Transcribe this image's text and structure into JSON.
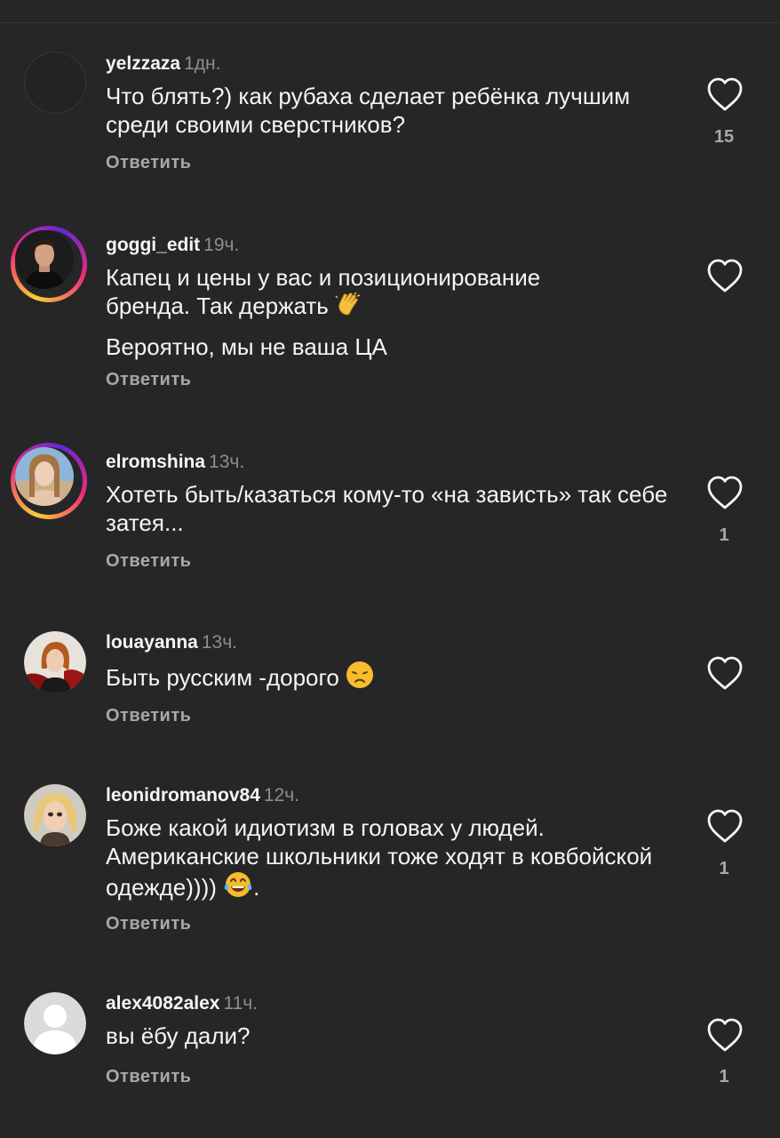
{
  "reply_label": "Ответить",
  "comments": [
    {
      "username": "yelzzaza",
      "time": "1дн.",
      "lines": [
        "Что блять?) как рубаха сделает ребёнка лучшим среди своими сверстников?"
      ],
      "likes": "15"
    },
    {
      "username": "goggi_edit",
      "time": "19ч.",
      "lines": [
        "Капец и цены у вас и позиционирование бренда. Так держать",
        "Вероятно, мы не ваша ЦА"
      ],
      "emoji": "clapping-hands-emoji",
      "likes": ""
    },
    {
      "username": "elromshina",
      "time": "13ч.",
      "lines": [
        "Хотеть быть/казаться кому-то «на зависть» так себе затея..."
      ],
      "likes": "1"
    },
    {
      "username": "louayanna",
      "time": "13ч.",
      "lines": [
        "Быть русским -дорого"
      ],
      "emoji": "disappointed-face-emoji",
      "likes": ""
    },
    {
      "username": "leonidromanov84",
      "time": "12ч.",
      "lines": [
        "Боже какой идиотизм в головах у людей. Американские школьники тоже ходят в ковбойской одежде))))",
        "."
      ],
      "emoji": "tears-of-joy-emoji",
      "likes": "1"
    },
    {
      "username": "alex4082alex",
      "time": "11ч.",
      "lines": [
        "вы ёбу дали?"
      ],
      "likes": "1"
    }
  ],
  "colors": {
    "background": "#262626",
    "primary_text": "#f5f5f5",
    "secondary_text": "#8e8e8e",
    "story_ring": [
      "#f9ce34",
      "#ee2a7b",
      "#6228d7"
    ]
  },
  "icons": [
    "heart-outline-icon",
    "default-avatar-icon"
  ]
}
